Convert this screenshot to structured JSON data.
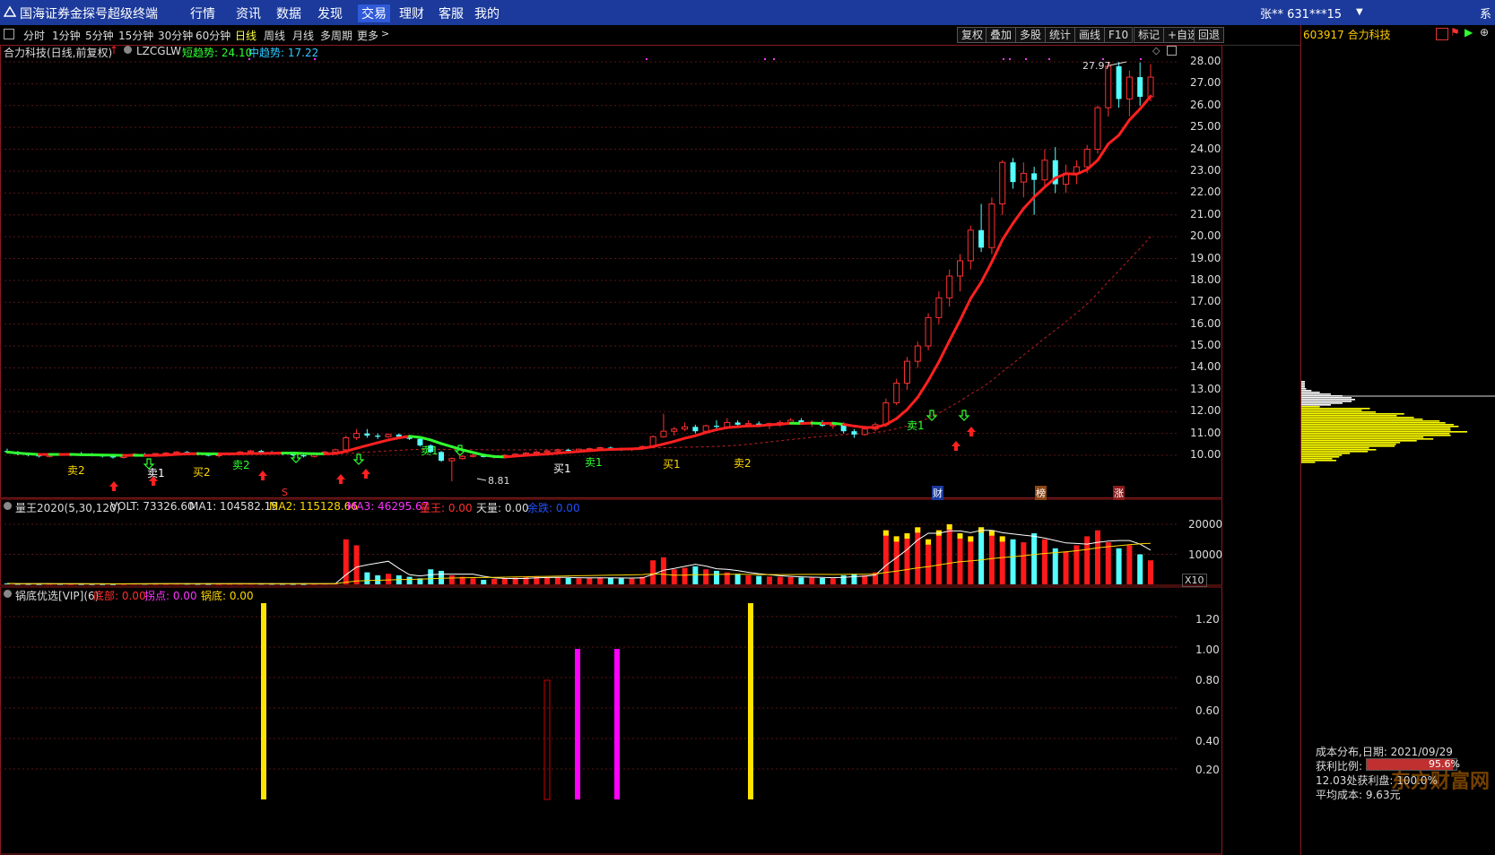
{
  "titlebar": {
    "app_title": "国海证券金探号超级终端",
    "menu": [
      "行情",
      "资讯",
      "数据",
      "发现",
      "交易",
      "理财",
      "客服",
      "我的"
    ],
    "account": "张**  631***15",
    "right_char": "系"
  },
  "toolbar": {
    "periods": [
      "分时",
      "1分钟",
      "5分钟",
      "15分钟",
      "30分钟",
      "60分钟",
      "日线",
      "周线",
      "月线",
      "多周期",
      "更多"
    ],
    "active_period": "日线",
    "tools": [
      "复权",
      "叠加",
      "多股",
      "统计",
      "画线",
      "F10",
      "标记",
      "+自选",
      "回退"
    ]
  },
  "stock": {
    "code_name": "603917 合力科技",
    "title": "合力科技(日线,前复权)",
    "indicator": "LZCGLW",
    "short_trend": "短趋势: 24.10",
    "mid_trend": "中趋势: 17.22",
    "high_label": "27.97",
    "low_label": "8.81",
    "markers": [
      "S",
      "财",
      "榜",
      "涨"
    ],
    "signal_labels": [
      "卖2",
      "卖1",
      "买1",
      "买2",
      "卖2",
      "卖1",
      "买1",
      "卖1",
      "卖2"
    ]
  },
  "price_axis": [
    "28.00",
    "27.00",
    "26.00",
    "25.00",
    "24.00",
    "23.00",
    "22.00",
    "21.00",
    "20.00",
    "19.00",
    "18.00",
    "17.00",
    "16.00",
    "15.00",
    "14.00",
    "13.00",
    "12.00",
    "11.00",
    "10.00"
  ],
  "volume_panel": {
    "name": "量王2020(5,30,120)",
    "volt": "VOLT: 73326.60",
    "ma1": "MA1: 104582.15",
    "ma2": "MA2: 115128.66",
    "ma3": "MA3: 46295.67",
    "liangwang": "量王: 0.00",
    "tianliang": "天量: 0.00",
    "yuliang": "余跌: 0.00",
    "axis": [
      "20000",
      "10000"
    ],
    "unit": "X10"
  },
  "bottom_panel": {
    "name": "锅底优选[VIP](6)",
    "dibu": "底部: 0.00",
    "guaidian": "拐点: 0.00",
    "guodi": "锅底: 0.00",
    "axis": [
      "1.20",
      "1.00",
      "0.80",
      "0.60",
      "0.40",
      "0.20"
    ]
  },
  "cost_panel": {
    "header": "成本分布,日期: 2021/09/29",
    "profit_ratio_label": "获利比例:",
    "profit_ratio": "95.6%",
    "line3": "12.03处获利盘: 100.0%",
    "line4": "平均成本: 9.63元",
    "watermark": "东方财富网"
  },
  "chart_data": {
    "type": "candlestick",
    "ylim": [
      9.0,
      28.5
    ],
    "candles": [
      [
        10.2,
        10.3,
        10.1,
        10.15
      ],
      [
        10.15,
        10.2,
        10.0,
        10.05
      ],
      [
        10.05,
        10.1,
        9.95,
        10.0
      ],
      [
        10.0,
        10.05,
        9.9,
        9.95
      ],
      [
        9.95,
        10.1,
        9.9,
        10.05
      ],
      [
        10.05,
        10.1,
        10.0,
        10.0
      ],
      [
        10.0,
        10.1,
        9.95,
        10.08
      ],
      [
        10.08,
        10.15,
        10.0,
        10.05
      ],
      [
        10.05,
        10.1,
        9.95,
        10.0
      ],
      [
        10.0,
        10.05,
        9.9,
        9.95
      ],
      [
        9.95,
        10.0,
        9.85,
        9.9
      ],
      [
        9.9,
        10.0,
        9.85,
        9.98
      ],
      [
        9.98,
        10.1,
        9.95,
        10.05
      ],
      [
        10.05,
        10.1,
        10.0,
        10.02
      ],
      [
        10.02,
        10.1,
        9.95,
        10.08
      ],
      [
        10.08,
        10.15,
        10.05,
        10.1
      ],
      [
        10.1,
        10.2,
        10.05,
        10.15
      ],
      [
        10.15,
        10.2,
        10.05,
        10.08
      ],
      [
        10.08,
        10.15,
        10.0,
        10.05
      ],
      [
        10.05,
        10.1,
        9.95,
        9.98
      ],
      [
        9.98,
        10.05,
        9.9,
        10.02
      ],
      [
        10.02,
        10.1,
        10.0,
        10.08
      ],
      [
        10.08,
        10.2,
        10.05,
        10.15
      ],
      [
        10.15,
        10.25,
        10.1,
        10.2
      ],
      [
        10.2,
        10.25,
        10.1,
        10.12
      ],
      [
        10.12,
        10.2,
        10.05,
        10.1
      ],
      [
        10.1,
        10.15,
        10.0,
        10.05
      ],
      [
        10.05,
        10.1,
        9.95,
        10.0
      ],
      [
        10.0,
        10.05,
        9.9,
        9.95
      ],
      [
        9.95,
        10.1,
        9.9,
        10.08
      ],
      [
        10.08,
        10.2,
        10.05,
        10.15
      ],
      [
        10.15,
        10.3,
        10.1,
        10.25
      ],
      [
        10.25,
        10.9,
        10.2,
        10.8
      ],
      [
        10.8,
        11.2,
        10.7,
        11.0
      ],
      [
        11.0,
        11.2,
        10.8,
        10.9
      ],
      [
        10.9,
        11.0,
        10.75,
        10.85
      ],
      [
        10.85,
        11.0,
        10.8,
        10.95
      ],
      [
        10.95,
        11.0,
        10.8,
        10.85
      ],
      [
        10.85,
        10.9,
        10.7,
        10.75
      ],
      [
        10.75,
        10.8,
        10.4,
        10.45
      ],
      [
        10.45,
        10.5,
        10.1,
        10.15
      ],
      [
        10.15,
        10.2,
        9.7,
        9.75
      ],
      [
        9.75,
        9.9,
        8.81,
        9.85
      ],
      [
        9.85,
        10.0,
        9.8,
        9.95
      ],
      [
        9.95,
        10.05,
        9.9,
        10.0
      ],
      [
        10.0,
        10.05,
        9.9,
        9.92
      ],
      [
        9.92,
        10.0,
        9.85,
        9.98
      ],
      [
        9.98,
        10.05,
        9.9,
        10.0
      ],
      [
        10.0,
        10.1,
        9.95,
        10.05
      ],
      [
        10.05,
        10.15,
        10.0,
        10.1
      ],
      [
        10.1,
        10.2,
        10.05,
        10.15
      ],
      [
        10.15,
        10.25,
        10.1,
        10.2
      ],
      [
        10.2,
        10.3,
        10.15,
        10.25
      ],
      [
        10.25,
        10.3,
        10.15,
        10.2
      ],
      [
        10.2,
        10.3,
        10.15,
        10.28
      ],
      [
        10.28,
        10.35,
        10.2,
        10.3
      ],
      [
        10.3,
        10.4,
        10.25,
        10.35
      ],
      [
        10.35,
        10.4,
        10.25,
        10.3
      ],
      [
        10.3,
        10.35,
        10.2,
        10.28
      ],
      [
        10.28,
        10.35,
        10.2,
        10.32
      ],
      [
        10.32,
        10.45,
        10.3,
        10.4
      ],
      [
        10.4,
        10.9,
        10.35,
        10.85
      ],
      [
        10.85,
        11.9,
        10.8,
        11.1
      ],
      [
        11.1,
        11.3,
        10.9,
        11.2
      ],
      [
        11.2,
        11.5,
        11.1,
        11.3
      ],
      [
        11.3,
        11.4,
        11.0,
        11.1
      ],
      [
        11.1,
        11.4,
        11.0,
        11.35
      ],
      [
        11.35,
        11.6,
        11.2,
        11.3
      ],
      [
        11.3,
        11.7,
        11.2,
        11.5
      ],
      [
        11.5,
        11.6,
        11.3,
        11.4
      ],
      [
        11.4,
        11.6,
        11.3,
        11.45
      ],
      [
        11.45,
        11.55,
        11.3,
        11.35
      ],
      [
        11.35,
        11.5,
        11.2,
        11.45
      ],
      [
        11.45,
        11.6,
        11.3,
        11.5
      ],
      [
        11.5,
        11.7,
        11.4,
        11.6
      ],
      [
        11.6,
        11.7,
        11.4,
        11.45
      ],
      [
        11.45,
        11.6,
        11.3,
        11.5
      ],
      [
        11.5,
        11.6,
        11.3,
        11.35
      ],
      [
        11.35,
        11.5,
        11.2,
        11.4
      ],
      [
        11.4,
        11.5,
        11.0,
        11.1
      ],
      [
        11.1,
        11.2,
        10.8,
        10.95
      ],
      [
        10.95,
        11.3,
        10.9,
        11.2
      ],
      [
        11.2,
        11.5,
        11.1,
        11.4
      ],
      [
        11.4,
        12.6,
        11.3,
        12.4
      ],
      [
        12.4,
        13.5,
        12.3,
        13.3
      ],
      [
        13.3,
        14.5,
        13.0,
        14.3
      ],
      [
        14.3,
        15.2,
        14.0,
        15.0
      ],
      [
        15.0,
        16.5,
        14.8,
        16.3
      ],
      [
        16.3,
        17.5,
        16.0,
        17.2
      ],
      [
        17.2,
        18.5,
        16.8,
        18.2
      ],
      [
        18.2,
        19.2,
        17.5,
        18.9
      ],
      [
        18.9,
        20.5,
        18.5,
        20.3
      ],
      [
        20.3,
        21.5,
        19.3,
        19.5
      ],
      [
        19.5,
        21.8,
        19.2,
        21.5
      ],
      [
        21.5,
        23.5,
        21.0,
        23.4
      ],
      [
        23.4,
        23.6,
        22.2,
        22.5
      ],
      [
        22.5,
        23.4,
        21.8,
        22.9
      ],
      [
        22.9,
        23.2,
        21.0,
        22.6
      ],
      [
        22.6,
        24.0,
        22.3,
        23.5
      ],
      [
        23.5,
        24.1,
        22.0,
        22.4
      ],
      [
        22.4,
        23.3,
        22.0,
        22.9
      ],
      [
        22.9,
        23.5,
        22.4,
        23.2
      ],
      [
        23.2,
        24.2,
        22.9,
        24.0
      ],
      [
        24.0,
        26.0,
        23.8,
        25.9
      ],
      [
        25.9,
        27.97,
        25.5,
        27.8
      ],
      [
        27.8,
        28.0,
        25.9,
        26.3
      ],
      [
        26.3,
        27.6,
        25.5,
        27.3
      ],
      [
        27.3,
        27.97,
        26.0,
        26.4
      ],
      [
        26.4,
        27.9,
        26.2,
        27.3
      ]
    ],
    "volume": [
      300,
      200,
      180,
      150,
      220,
      200,
      180,
      160,
      150,
      140,
      130,
      200,
      260,
      240,
      220,
      230,
      250,
      240,
      200,
      180,
      200,
      230,
      250,
      260,
      240,
      220,
      200,
      180,
      160,
      220,
      260,
      300,
      15000,
      13000,
      4000,
      3000,
      3500,
      3000,
      2500,
      2000,
      5000,
      4500,
      3000,
      2500,
      2000,
      1500,
      1800,
      2000,
      2200,
      2400,
      2500,
      2300,
      2200,
      2100,
      2000,
      2200,
      2300,
      2100,
      2000,
      1900,
      2500,
      8000,
      9000,
      5000,
      5500,
      6000,
      5000,
      4500,
      4000,
      3500,
      3000,
      2800,
      2600,
      2500,
      2400,
      2300,
      2200,
      2100,
      2000,
      3000,
      3500,
      3000,
      4000,
      18000,
      16000,
      17000,
      19000,
      15000,
      18000,
      20000,
      17000,
      16000,
      19000,
      18000,
      16000,
      15000,
      14000,
      17000,
      15000,
      12000,
      11000,
      13000,
      16000,
      18000,
      14000,
      12000,
      13000,
      10000,
      8000
    ]
  }
}
